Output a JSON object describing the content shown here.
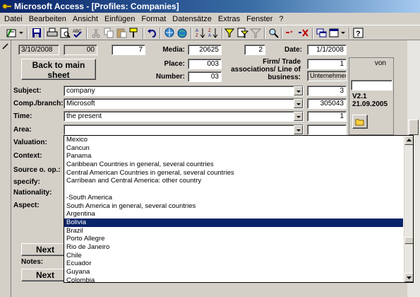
{
  "window": {
    "title": "Microsoft Access - [Profiles: Companies]"
  },
  "menu": [
    "Datei",
    "Bearbeiten",
    "Ansicht",
    "Einfügen",
    "Format",
    "Datensätze",
    "Extras",
    "Fenster",
    "?"
  ],
  "record": {
    "date": "3/10/2008",
    "code": "00",
    "num1": "7",
    "media_label": "Media:",
    "media": "20625",
    "num2": "2",
    "date_label": "Date:",
    "date2": "1/1/2008",
    "place_label": "Place:",
    "place": "003",
    "firm_label": "Firm/ Trade associations/ Line of business:",
    "firm": "1",
    "number_label": "Number:",
    "number": "03",
    "firm_type": "Unternehmen",
    "von": "von",
    "version": "V2.1",
    "version_date": "21.09.2005"
  },
  "buttons": {
    "back_main": "Back to main sheet",
    "next_a": "Next as",
    "next_p": "Next pr"
  },
  "fields": {
    "subject_label": "Subject:",
    "subject": "company",
    "subject_num": "3",
    "branch_label": "Comp./branch:",
    "branch": "Microsoft",
    "branch_num": "305043",
    "time_label": "Time:",
    "time": "the present",
    "time_num": "1",
    "area_label": "Area:",
    "area": "",
    "valuation_label": "Valuation:",
    "context_label": "Context:",
    "source_label": "Source o. op.:",
    "specify_label": "specify:",
    "nationality_label": "Nationality:",
    "aspect_label": "Aspect:",
    "notes_label": "Notes:"
  },
  "dropdown": {
    "items": [
      "Mexico",
      "Cancun",
      "Panama",
      "Caribbean Countries in general, several countries",
      "Central American Countries in general, several countries",
      "Carribean and Central America: other country",
      "",
      "-South America",
      "South America in general, several countries",
      "Argentina",
      "Bolivia",
      "Brazil",
      "Porto Allegre",
      "Rio de Janeiro",
      "Chile",
      "Ecuador",
      "Guyana",
      "Colombia"
    ],
    "selected_index": 10
  },
  "colors": {
    "selection": "#0a246a",
    "titlebar": "#0a246a",
    "face": "#d4d0c8"
  }
}
